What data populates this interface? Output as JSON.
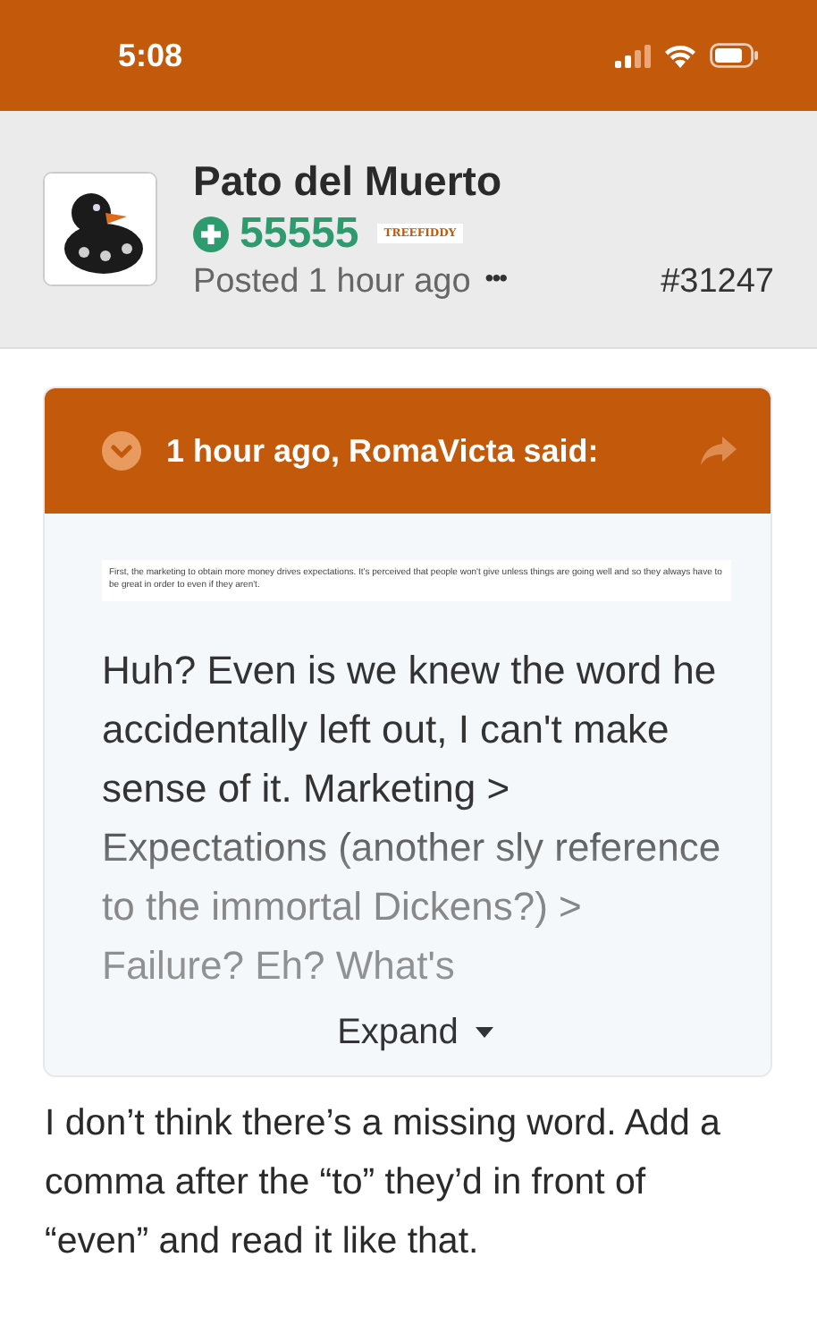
{
  "status_bar": {
    "time": "5:08"
  },
  "post": {
    "author": "Pato del Muerto",
    "reputation": "55555",
    "badge": "TREEFIDDY",
    "posted": "Posted 1 hour ago",
    "more": "•••",
    "number": "#31247"
  },
  "quote": {
    "header": "1 hour ago, RomaVicta said:",
    "image_text": "First, the marketing to obtain more money drives expectations. It's perceived that people won't give unless things are going well and so they always have to be great in order to even if they aren't.",
    "body": "Huh? Even is we knew the word he accidentally left out, I can't make sense of it. Marketing > Expectations (another sly reference to the immortal Dickens?) > Failure? Eh? What's",
    "expand": "Expand"
  },
  "reply": "I don’t think there’s a missing word. Add a comma after the “to” they’d in front of “even” and read it like that."
}
